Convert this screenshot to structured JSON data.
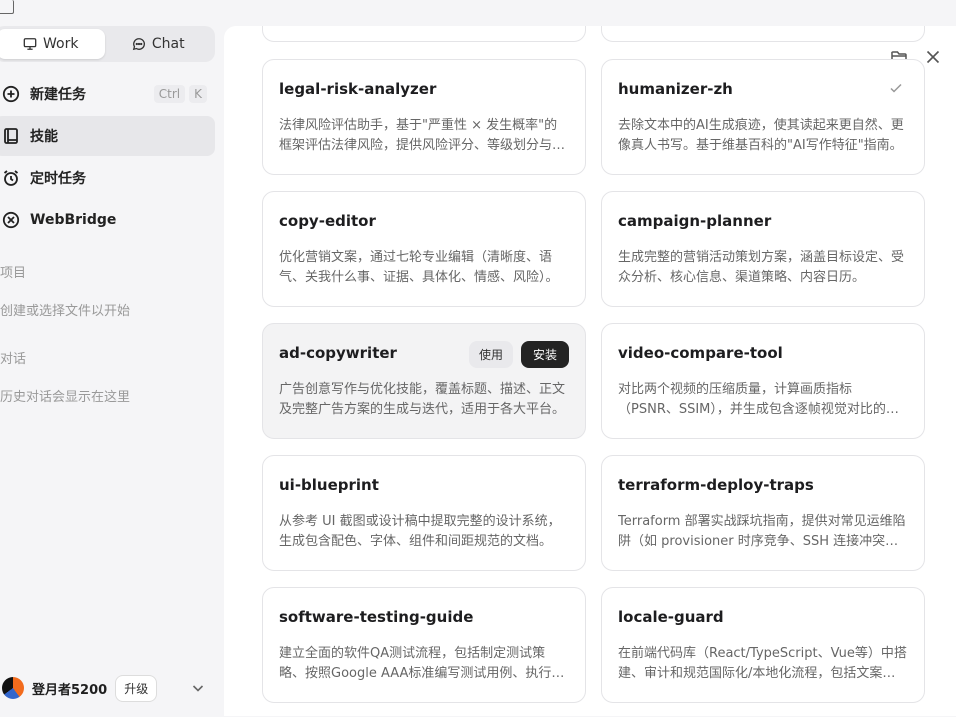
{
  "sidebar": {
    "modes": [
      {
        "label": "Work",
        "active": true,
        "icon": "monitor-icon"
      },
      {
        "label": "Chat",
        "active": false,
        "icon": "chat-bubble-icon"
      }
    ],
    "items": [
      {
        "label": "新建任务",
        "icon": "plus-circle-icon",
        "shortcut": [
          "Ctrl",
          "K"
        ],
        "active": false
      },
      {
        "label": "技能",
        "icon": "book-icon",
        "active": true
      },
      {
        "label": "定时任务",
        "icon": "alarm-clock-icon",
        "active": false
      },
      {
        "label": "WebBridge",
        "icon": "bridge-icon",
        "active": false
      }
    ],
    "projects_label": "项目",
    "projects_hint": "创建或选择文件以开始",
    "chats_label": "对话",
    "chats_hint": "历史对话会显示在这里",
    "user": {
      "name": "登月者5200",
      "upgrade_label": "升级"
    }
  },
  "skills": [
    {
      "name": "legal-risk-analyzer",
      "desc": "法律风险评估助手，基于\"严重性 × 发生概率\"的框架评估法律风险，提供风险评分、等级划分与缓解建议。",
      "state": "none"
    },
    {
      "name": "humanizer-zh",
      "desc": "去除文本中的AI生成痕迹，使其读起来更自然、更像真人书写。基于维基百科的\"AI写作特征\"指南。",
      "state": "installed"
    },
    {
      "name": "copy-editor",
      "desc": "优化营销文案，通过七轮专业编辑（清晰度、语气、关我什么事、证据、具体化、情感、风险）。",
      "state": "none"
    },
    {
      "name": "campaign-planner",
      "desc": "生成完整的营销活动策划方案，涵盖目标设定、受众分析、核心信息、渠道策略、内容日历。",
      "state": "none"
    },
    {
      "name": "ad-copywriter",
      "desc": "广告创意写作与优化技能，覆盖标题、描述、正文及完整广告方案的生成与迭代，适用于各大平台。",
      "state": "hover"
    },
    {
      "name": "video-compare-tool",
      "desc": "对比两个视频的压缩质量，计算画质指标（PSNR、SSIM），并生成包含逐帧视觉对比的报告。",
      "state": "none"
    },
    {
      "name": "ui-blueprint",
      "desc": "从参考 UI 截图或设计稿中提取完整的设计系统，生成包含配色、字体、组件和间距规范的文档。",
      "state": "none"
    },
    {
      "name": "terraform-deploy-traps",
      "desc": "Terraform 部署实战踩坑指南，提供对常见运维陷阱（如 provisioner 时序竞争、SSH 连接冲突等）的解决方案。",
      "state": "none"
    },
    {
      "name": "software-testing-guide",
      "desc": "建立全面的软件QA测试流程，包括制定测试策略、按照Google AAA标准编写测试用例、执行与报告。",
      "state": "none"
    },
    {
      "name": "locale-guard",
      "desc": "在前端代码库（React/TypeScript、Vue等）中搭建、审计和规范国际化/本地化流程，包括文案提取。",
      "state": "none"
    }
  ],
  "card_actions": {
    "use_label": "使用",
    "install_label": "安装"
  }
}
